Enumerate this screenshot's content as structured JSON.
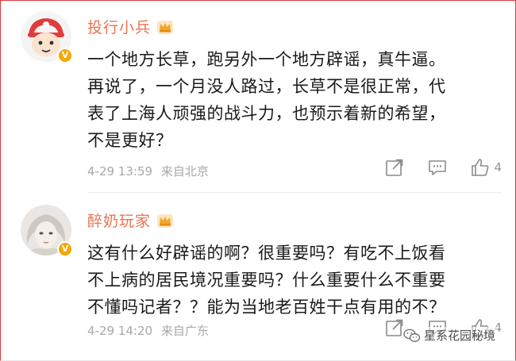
{
  "colors": {
    "accent_username": "#eb7350",
    "body_text": "#1a1a1a",
    "meta_text": "#a8a8a8",
    "verified_badge": "#f7a600",
    "frame_border": "#e4393c"
  },
  "comments": [
    {
      "username": "投行小兵",
      "badge_icon": "crown-icon",
      "lines": [
        "一个地方长草，跑另外一个地方辟谣，真牛逼。",
        "再说了，一个月没人路过，长草不是很正常，代",
        "表了上海人顽强的战斗力，也预示着新的希望，",
        "不是更好？"
      ],
      "date": "4-29 13:59",
      "location": "来自北京",
      "likes": "4"
    },
    {
      "username": "醉奶玩家",
      "badge_icon": "crown-icon",
      "lines": [
        "这有什么好辟谣的啊？很重要吗？有吃不上饭看",
        "不上病的居民境况重要吗？什么重要什么不重要",
        "不懂吗记者？？能为当地老百姓干点有用的不？"
      ],
      "date": "4-29 14:20",
      "location": "来自广东",
      "likes": "4"
    }
  ],
  "watermark": {
    "text": "星系花园秘境"
  }
}
